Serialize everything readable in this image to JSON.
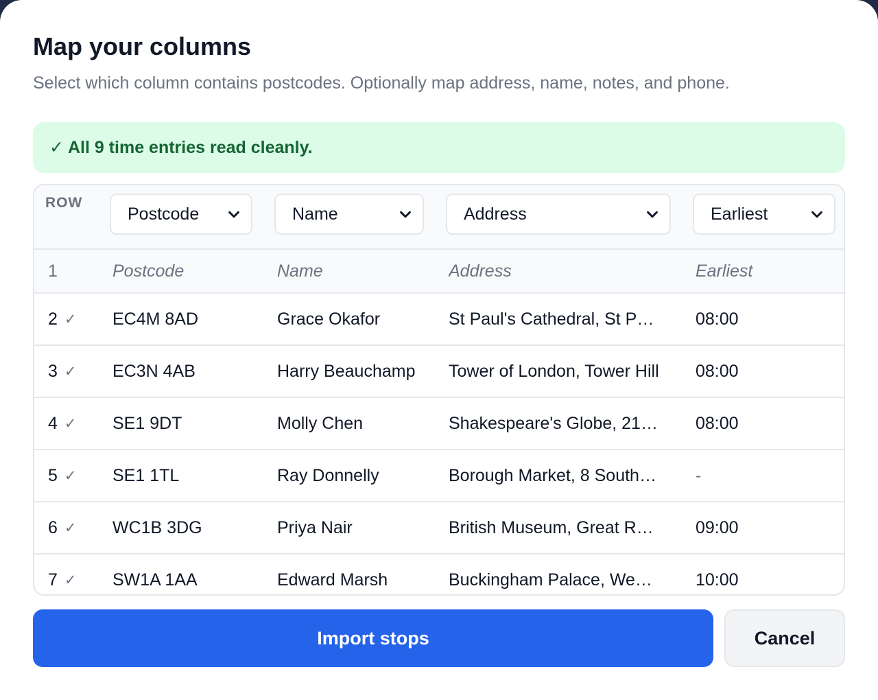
{
  "dialog": {
    "title": "Map your columns",
    "subtitle": "Select which column contains postcodes. Optionally map address, name, notes, and phone."
  },
  "banner": {
    "text": "✓ All 9 time entries read cleanly.",
    "color": "#166534",
    "background": "#dcfce7"
  },
  "table": {
    "row_header": "ROW",
    "mappings": [
      "Postcode",
      "Name",
      "Address",
      "Earliest"
    ],
    "raw_header": {
      "row": "1",
      "cells": [
        "Postcode",
        "Name",
        "Address",
        "Earliest"
      ]
    },
    "rows": [
      {
        "row": "2",
        "check": "✓",
        "postcode": "EC4M 8AD",
        "name": "Grace Okafor",
        "address": "St Paul's Cathedral, St P…",
        "earliest": "08:00"
      },
      {
        "row": "3",
        "check": "✓",
        "postcode": "EC3N 4AB",
        "name": "Harry Beauchamp",
        "address": "Tower of London, Tower Hill",
        "earliest": "08:00"
      },
      {
        "row": "4",
        "check": "✓",
        "postcode": "SE1 9DT",
        "name": "Molly Chen",
        "address": "Shakespeare's Globe, 21…",
        "earliest": "08:00"
      },
      {
        "row": "5",
        "check": "✓",
        "postcode": "SE1 1TL",
        "name": "Ray Donnelly",
        "address": "Borough Market, 8 South…",
        "earliest": "-"
      },
      {
        "row": "6",
        "check": "✓",
        "postcode": "WC1B 3DG",
        "name": "Priya Nair",
        "address": "British Museum, Great R…",
        "earliest": "09:00"
      },
      {
        "row": "7",
        "check": "✓",
        "postcode": "SW1A 1AA",
        "name": "Edward Marsh",
        "address": "Buckingham Palace, We…",
        "earliest": "10:00"
      }
    ]
  },
  "actions": {
    "import_label": "Import stops",
    "cancel_label": "Cancel",
    "accent": "#2563eb"
  },
  "icons": {
    "select_chevron": "chevron-down-icon",
    "row_check": "check-icon"
  }
}
